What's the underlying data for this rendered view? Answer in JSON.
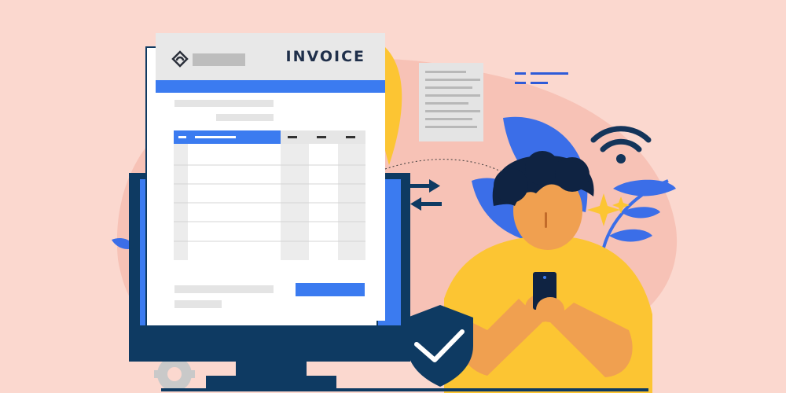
{
  "invoice": {
    "title": "INVOICE"
  },
  "colors": {
    "background": "#fbd8cf",
    "blob": "#f7c2b6",
    "navy": "#0e3a62",
    "blue": "#3b7bf0",
    "yellow": "#fcc533",
    "skin": "#f0a050"
  },
  "icons": [
    "invoice-logo-icon",
    "wifi-icon",
    "shield-check-icon",
    "gear-icon",
    "sparkle-icon",
    "phone-icon",
    "arrow-right-icon",
    "arrow-left-icon"
  ]
}
